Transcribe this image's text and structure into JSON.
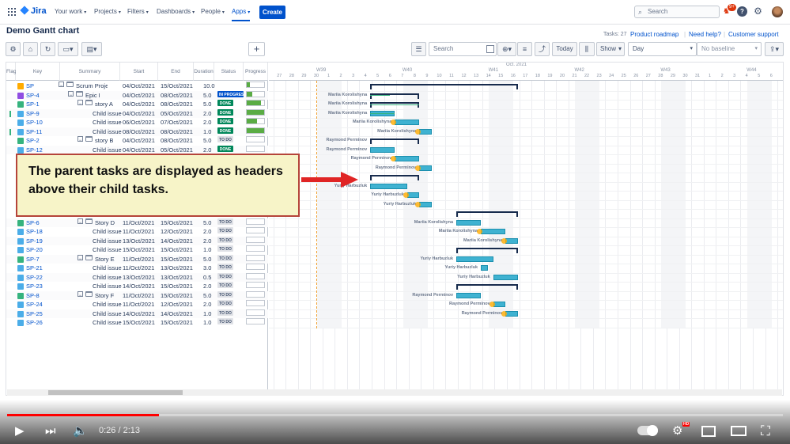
{
  "nav": {
    "logo": "Jira",
    "items": [
      "Your work",
      "Projects",
      "Filters",
      "Dashboards",
      "People",
      "Apps"
    ],
    "create": "Create",
    "search_placeholder": "Search",
    "notif_badge": "9+"
  },
  "page": {
    "title": "Demo Gantt chart",
    "tasks_count": "Tasks: 27",
    "links": [
      "Product roadmap",
      "Need help?",
      "Customer support"
    ]
  },
  "toolbar": {
    "search_placeholder": "Search",
    "today": "Today",
    "show": "Show",
    "scale": "Day",
    "baseline": "No baseline"
  },
  "table": {
    "headers": [
      "Flag",
      "Key",
      "Summary",
      "Start",
      "End",
      "Duration",
      "Status",
      "Progress"
    ],
    "rows": [
      {
        "key": "SP",
        "summary": "Scrum Project",
        "start": "04/Oct/2021",
        "end": "15/Oct/2021",
        "duration": "10.0",
        "status": "",
        "progress": 0.2,
        "level": 0,
        "type": "project",
        "flag": false
      },
      {
        "key": "SP-4",
        "summary": "Epic I",
        "start": "04/Oct/2021",
        "end": "08/Oct/2021",
        "duration": "5.0",
        "status": "IN PROGRESS",
        "progress": 0.3,
        "level": 1,
        "type": "epic",
        "flag": false
      },
      {
        "key": "SP-1",
        "summary": "story A",
        "start": "04/Oct/2021",
        "end": "08/Oct/2021",
        "duration": "5.0",
        "status": "DONE",
        "progress": 0.8,
        "level": 2,
        "type": "story",
        "flag": false
      },
      {
        "key": "SP-9",
        "summary": "Child issue",
        "start": "04/Oct/2021",
        "end": "05/Oct/2021",
        "duration": "2.0",
        "status": "DONE",
        "progress": 1.0,
        "level": 3,
        "type": "task",
        "flag": true
      },
      {
        "key": "SP-10",
        "summary": "Child issue",
        "start": "06/Oct/2021",
        "end": "07/Oct/2021",
        "duration": "2.0",
        "status": "DONE",
        "progress": 0.6,
        "level": 3,
        "type": "task",
        "flag": false
      },
      {
        "key": "SP-11",
        "summary": "Child issue",
        "start": "08/Oct/2021",
        "end": "08/Oct/2021",
        "duration": "1.0",
        "status": "DONE",
        "progress": 1.0,
        "level": 3,
        "type": "task",
        "flag": true
      },
      {
        "key": "SP-2",
        "summary": "story B",
        "start": "04/Oct/2021",
        "end": "08/Oct/2021",
        "duration": "5.0",
        "status": "TO DO",
        "progress": 0,
        "level": 2,
        "type": "story",
        "flag": false
      },
      {
        "key": "SP-12",
        "summary": "Child issue",
        "start": "04/Oct/2021",
        "end": "05/Oct/2021",
        "duration": "2.0",
        "status": "DONE",
        "progress": 0,
        "level": 3,
        "type": "task",
        "flag": false
      },
      {
        "key": "",
        "summary": "",
        "start": "",
        "end": "",
        "duration": "",
        "status": "",
        "progress": 0,
        "level": 0,
        "type": "hidden",
        "flag": false
      },
      {
        "key": "",
        "summary": "",
        "start": "",
        "end": "",
        "duration": "",
        "status": "",
        "progress": 0,
        "level": 0,
        "type": "hidden",
        "flag": false
      },
      {
        "key": "",
        "summary": "",
        "start": "",
        "end": "",
        "duration": "",
        "status": "",
        "progress": 0,
        "level": 0,
        "type": "hidden",
        "flag": false
      },
      {
        "key": "",
        "summary": "",
        "start": "",
        "end": "",
        "duration": "",
        "status": "",
        "progress": 0,
        "level": 0,
        "type": "hidden",
        "flag": false
      },
      {
        "key": "",
        "summary": "",
        "start": "",
        "end": "",
        "duration": "",
        "status": "",
        "progress": 0,
        "level": 0,
        "type": "hidden",
        "flag": false
      },
      {
        "key": "",
        "summary": "",
        "start": "",
        "end": "",
        "duration": "",
        "status": "",
        "progress": 0,
        "level": 0,
        "type": "hidden",
        "flag": false
      },
      {
        "key": "",
        "summary": "",
        "start": "",
        "end": "",
        "duration": "",
        "status": "",
        "progress": 0,
        "level": 0,
        "type": "hidden",
        "flag": false
      },
      {
        "key": "SP-6",
        "summary": "Story D",
        "start": "11/Oct/2021",
        "end": "15/Oct/2021",
        "duration": "5.0",
        "status": "TO DO",
        "progress": 0,
        "level": 2,
        "type": "story",
        "flag": false
      },
      {
        "key": "SP-18",
        "summary": "Child issue",
        "start": "11/Oct/2021",
        "end": "12/Oct/2021",
        "duration": "2.0",
        "status": "TO DO",
        "progress": 0,
        "level": 3,
        "type": "task",
        "flag": false
      },
      {
        "key": "SP-19",
        "summary": "Child issue",
        "start": "13/Oct/2021",
        "end": "14/Oct/2021",
        "duration": "2.0",
        "status": "TO DO",
        "progress": 0,
        "level": 3,
        "type": "task",
        "flag": false
      },
      {
        "key": "SP-20",
        "summary": "Child issue",
        "start": "15/Oct/2021",
        "end": "15/Oct/2021",
        "duration": "1.0",
        "status": "TO DO",
        "progress": 0,
        "level": 3,
        "type": "task",
        "flag": false
      },
      {
        "key": "SP-7",
        "summary": "Story E",
        "start": "11/Oct/2021",
        "end": "15/Oct/2021",
        "duration": "5.0",
        "status": "TO DO",
        "progress": 0,
        "level": 2,
        "type": "story",
        "flag": false
      },
      {
        "key": "SP-21",
        "summary": "Child issue",
        "start": "11/Oct/2021",
        "end": "13/Oct/2021",
        "duration": "3.0",
        "status": "TO DO",
        "progress": 0,
        "level": 3,
        "type": "task",
        "flag": false
      },
      {
        "key": "SP-22",
        "summary": "Child issue",
        "start": "13/Oct/2021",
        "end": "13/Oct/2021",
        "duration": "0.5",
        "status": "TO DO",
        "progress": 0,
        "level": 3,
        "type": "task",
        "flag": false
      },
      {
        "key": "SP-23",
        "summary": "Child issue",
        "start": "14/Oct/2021",
        "end": "15/Oct/2021",
        "duration": "2.0",
        "status": "TO DO",
        "progress": 0,
        "level": 3,
        "type": "task",
        "flag": false
      },
      {
        "key": "SP-8",
        "summary": "Story F",
        "start": "11/Oct/2021",
        "end": "15/Oct/2021",
        "duration": "5.0",
        "status": "TO DO",
        "progress": 0,
        "level": 2,
        "type": "story",
        "flag": false
      },
      {
        "key": "SP-24",
        "summary": "Child issue",
        "start": "11/Oct/2021",
        "end": "12/Oct/2021",
        "duration": "2.0",
        "status": "TO DO",
        "progress": 0,
        "level": 3,
        "type": "task",
        "flag": false
      },
      {
        "key": "SP-25",
        "summary": "Child issue",
        "start": "14/Oct/2021",
        "end": "14/Oct/2021",
        "duration": "1.0",
        "status": "TO DO",
        "progress": 0,
        "level": 3,
        "type": "task",
        "flag": false
      },
      {
        "key": "SP-26",
        "summary": "Child issue",
        "start": "15/Oct/2021",
        "end": "15/Oct/2021",
        "duration": "1.0",
        "status": "TO DO",
        "progress": 0,
        "level": 3,
        "type": "task",
        "flag": false
      }
    ]
  },
  "timeline": {
    "month": "Oct. 2021",
    "weeks": [
      "W39",
      "W40",
      "W41",
      "W42",
      "W43",
      "W44"
    ],
    "days": [
      "6",
      "27",
      "28",
      "29",
      "30",
      "1",
      "2",
      "3",
      "4",
      "5",
      "6",
      "7",
      "8",
      "9",
      "10",
      "11",
      "12",
      "13",
      "14",
      "15",
      "16",
      "17",
      "18",
      "19",
      "20",
      "21",
      "22",
      "23",
      "24",
      "25",
      "26",
      "27",
      "28",
      "29",
      "30",
      "31",
      "1",
      "2",
      "3",
      "4",
      "5",
      "6"
    ],
    "today_col": 3.55,
    "parents": [
      {
        "row": 0,
        "from": 8,
        "to": 20
      },
      {
        "row": 1,
        "from": 8,
        "to": 12
      },
      {
        "row": 2,
        "from": 8,
        "to": 12
      },
      {
        "row": 6,
        "from": 8,
        "to": 12
      },
      {
        "row": 10,
        "from": 8,
        "to": 12
      },
      {
        "row": 14,
        "from": 15,
        "to": 20
      },
      {
        "row": 18,
        "from": 15,
        "to": 20
      },
      {
        "row": 22,
        "from": 15,
        "to": 20
      }
    ],
    "tasks": [
      {
        "row": 3,
        "from": 8,
        "to": 10,
        "assignee": "Mariia Korolishyna",
        "green": true
      },
      {
        "row": 4,
        "from": 10,
        "to": 12,
        "assignee": "Mariia Korolishyna",
        "link": true
      },
      {
        "row": 5,
        "from": 12,
        "to": 13,
        "assignee": "Mariia Korolishyna",
        "link": true
      },
      {
        "row": 7,
        "from": 8,
        "to": 10,
        "assignee": "Raymond Perminov"
      },
      {
        "row": 8,
        "from": 10,
        "to": 12,
        "assignee": "Raymond Perminov",
        "link": true
      },
      {
        "row": 9,
        "from": 12,
        "to": 13,
        "assignee": "Raymond Perminov",
        "link": true
      },
      {
        "row": 11,
        "from": 8,
        "to": 11,
        "assignee": "Yuriy Harbuzluk"
      },
      {
        "row": 12,
        "from": 11,
        "to": 12,
        "assignee": "Yuriy Harbuzluk",
        "link": true
      },
      {
        "row": 13,
        "from": 12,
        "to": 13,
        "assignee": "Yuriy Harbuzluk",
        "link": true
      },
      {
        "row": 15,
        "from": 15,
        "to": 17,
        "assignee": "Mariia Korolishyna"
      },
      {
        "row": 16,
        "from": 17,
        "to": 19,
        "assignee": "Mariia Korolishyna",
        "link": true
      },
      {
        "row": 17,
        "from": 19,
        "to": 20,
        "assignee": "Mariia Korolishyna",
        "link": true
      },
      {
        "row": 19,
        "from": 15,
        "to": 18,
        "assignee": "Yuriy Harbuzluk"
      },
      {
        "row": 20,
        "from": 17,
        "to": 17.6,
        "assignee": "Yuriy Harbuzluk"
      },
      {
        "row": 21,
        "from": 18,
        "to": 20,
        "assignee": "Yuriy Harbuzluk"
      },
      {
        "row": 23,
        "from": 15,
        "to": 17,
        "assignee": "Raymond Perminov"
      },
      {
        "row": 24,
        "from": 18,
        "to": 19,
        "assignee": "Raymond Perminov",
        "link": true
      },
      {
        "row": 25,
        "from": 19,
        "to": 20,
        "assignee": "Raymond Perminov",
        "link": true
      }
    ],
    "header_assignees": [
      {
        "row": 6,
        "name": "Raymond Perminov"
      },
      {
        "row": 1,
        "name": "Mariia Korolishyna"
      },
      {
        "row": 2,
        "name": "Mariia Korolishyna"
      }
    ]
  },
  "callout": {
    "text": "The parent tasks are displayed as headers above their child tasks.",
    "color": "#b5443a"
  },
  "player": {
    "time": "0:26 / 2:13",
    "progress": 0.196,
    "hd": "HD"
  },
  "colors": {
    "accent": "#0052cc",
    "done": "#00875a",
    "bar": "#3fb2d1",
    "progress": "#ff0000"
  }
}
